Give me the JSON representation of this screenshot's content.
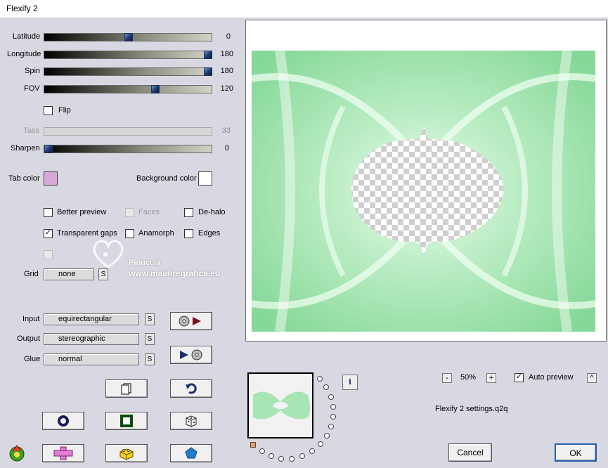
{
  "window": {
    "title": "Flexify 2"
  },
  "sliders": [
    {
      "label": "Latitude",
      "value": "0",
      "position": 0.5
    },
    {
      "label": "Longitude",
      "value": "180",
      "position": 1.0
    },
    {
      "label": "Spin",
      "value": "180",
      "position": 1.0
    },
    {
      "label": "FOV",
      "value": "120",
      "position": 0.66
    },
    {
      "label": "Tabs",
      "value": "33",
      "disabled": true
    },
    {
      "label": "Sharpen",
      "value": "0",
      "position": 0.0
    }
  ],
  "flip": {
    "label": "Flip",
    "checked": false
  },
  "tab_color": {
    "label": "Tab color",
    "color": "#d8a8d8"
  },
  "background_color": {
    "label": "Background color",
    "color": "#ffffff"
  },
  "options": {
    "better_preview": {
      "label": "Better preview",
      "checked": false
    },
    "faces": {
      "label": "Faces",
      "checked": false,
      "disabled": true
    },
    "de_halo": {
      "label": "De-halo",
      "checked": false
    },
    "transparent_gaps": {
      "label": "Transparent gaps",
      "checked": true
    },
    "anamorph": {
      "label": "Anamorph",
      "checked": false
    },
    "edges": {
      "label": "Edges",
      "checked": false
    }
  },
  "grid": {
    "label": "Grid",
    "value": "none"
  },
  "input": {
    "label": "Input",
    "value": "equirectangular"
  },
  "output": {
    "label": "Output",
    "value": "stereographic"
  },
  "glue": {
    "label": "Glue",
    "value": "normal"
  },
  "shuffle_label": "S",
  "watermark": {
    "line1": "Pinuccia",
    "line2": "www.maidiregrafica.eu"
  },
  "zoom": {
    "minus": "-",
    "value": "50%",
    "plus": "+"
  },
  "auto_preview": {
    "label": "Auto preview",
    "checked": true
  },
  "collapse_label": "^",
  "settings_file": "Flexify 2 settings.q2q",
  "info_label": "i",
  "buttons": {
    "cancel": "Cancel",
    "ok": "OK"
  },
  "colors": {
    "accent": "#1c3c78",
    "dialog_bg": "#d8d8e2",
    "preview_green": "#a8e0b0"
  }
}
